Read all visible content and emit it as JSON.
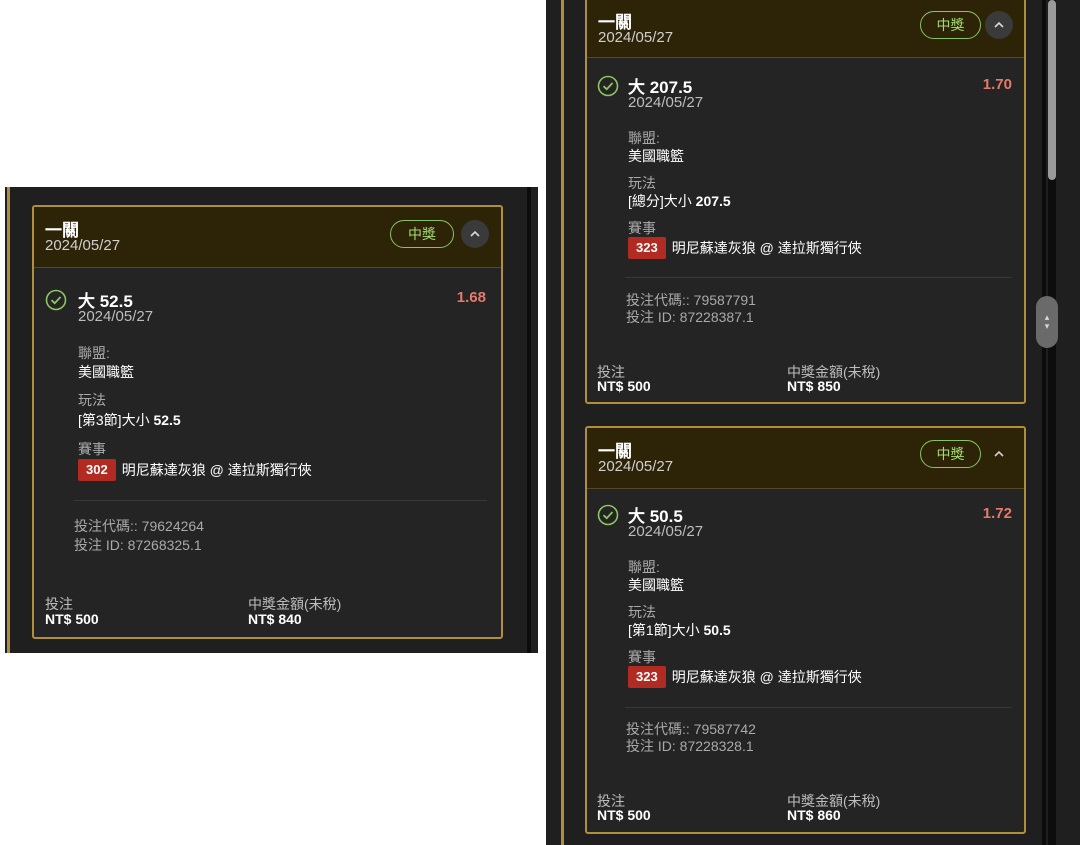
{
  "cards": [
    {
      "title": "一關",
      "date": "2024/05/27",
      "badge": "中獎",
      "selection": "大 52.5",
      "selection_date": "2024/05/27",
      "odds": "1.68",
      "league_label": "聯盟:",
      "league": "美國職籃",
      "play_label": "玩法",
      "play_prefix": "[第3節]大小",
      "play_line": "52.5",
      "event_label": "賽事",
      "event_no": "302",
      "event_name": "明尼蘇達灰狼 @ 達拉斯獨行俠",
      "bet_code": "投注代碼:: 79624264",
      "bet_id": "投注 ID: 87268325.1",
      "stake_label": "投注",
      "stake": "NT$ 500",
      "payout_label": "中獎金額(未稅)",
      "payout": "NT$ 840"
    },
    {
      "title": "一關",
      "date": "2024/05/27",
      "badge": "中獎",
      "selection": "大 207.5",
      "selection_date": "2024/05/27",
      "odds": "1.70",
      "league_label": "聯盟:",
      "league": "美國職籃",
      "play_label": "玩法",
      "play_prefix": "[總分]大小",
      "play_line": "207.5",
      "event_label": "賽事",
      "event_no": "323",
      "event_name": "明尼蘇達灰狼 @ 達拉斯獨行俠",
      "bet_code": "投注代碼:: 79587791",
      "bet_id": "投注 ID: 87228387.1",
      "stake_label": "投注",
      "stake": "NT$ 500",
      "payout_label": "中獎金額(未稅)",
      "payout": "NT$ 850"
    },
    {
      "title": "一關",
      "date": "2024/05/27",
      "badge": "中獎",
      "selection": "大 50.5",
      "selection_date": "2024/05/27",
      "odds": "1.72",
      "league_label": "聯盟:",
      "league": "美國職籃",
      "play_label": "玩法",
      "play_prefix": "[第1節]大小",
      "play_line": "50.5",
      "event_label": "賽事",
      "event_no": "323",
      "event_name": "明尼蘇達灰狼 @ 達拉斯獨行俠",
      "bet_code": "投注代碼:: 79587742",
      "bet_id": "投注 ID: 87228328.1",
      "stake_label": "投注",
      "stake": "NT$ 500",
      "payout_label": "中獎金額(未稅)",
      "payout": "NT$ 860"
    }
  ],
  "icons": {
    "check": "check-circle-icon",
    "collapse": "chevron-up-icon",
    "scroll_handle": "drag-handle-icon"
  },
  "colors": {
    "gold_border": "#b08e3a",
    "header_bg": "#2d2408",
    "win_green": "#a4dc6f",
    "odds_red": "#e47a6b",
    "event_tag_red": "#b12b22"
  }
}
